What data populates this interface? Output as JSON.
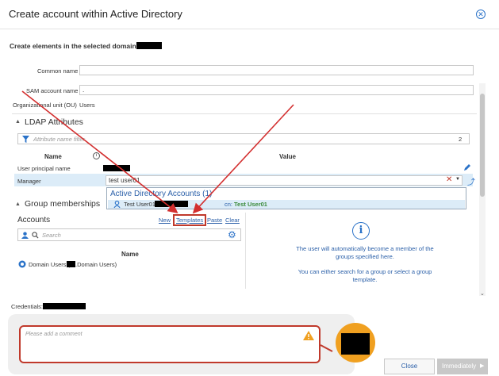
{
  "dialog": {
    "title": "Create account within Active Directory",
    "subtitle": "Create elements in the selected domain:"
  },
  "form": {
    "common_name_label": "Common name",
    "common_name_value": "",
    "sam_label": "SAM account name",
    "sam_value": ".",
    "ou_label": "Organizational unit (OU)",
    "ou_value": "Users"
  },
  "ldap": {
    "header": "LDAP Attributes",
    "filter_placeholder": "Attribute name filter",
    "filter_count": "2",
    "col_name": "Name",
    "col_value": "Value",
    "rows": [
      {
        "name": "User principal name"
      },
      {
        "name": "Manager",
        "value": "test user01"
      }
    ]
  },
  "dropdown": {
    "group_label": "Active Directory Accounts (1)",
    "item_name": "Test User01",
    "item_cn_prefix": "cn:",
    "item_cn": "Test User01"
  },
  "groups": {
    "header": "Group memberships",
    "accounts_label": "Accounts",
    "links": {
      "new": "New",
      "templates": "Templates",
      "paste": "Paste",
      "clear": "Clear"
    },
    "search_placeholder": "Search",
    "col_name": "Name",
    "items": [
      {
        "prefix": "Domain Users (",
        "suffix": ".Domain Users)"
      }
    ],
    "info_line1": "The user will automatically become a member of the",
    "info_line2": "groups specified here.",
    "info_line3": "You can either search for a group or select a group",
    "info_line4": "template."
  },
  "credentials_label": "Credentials:",
  "comment_placeholder": "Please add a comment",
  "buttons": {
    "close": "Close",
    "immediately": "Immediately"
  },
  "colors": {
    "accent": "#2a72c8",
    "annotation": "#c0392b",
    "avatar": "#f0a020",
    "highlight_row": "#dcecf8"
  },
  "icons": [
    "close-circle-icon",
    "chevron-up-icon",
    "filter-icon",
    "info-icon",
    "edit-icon",
    "upload-icon",
    "clear-x-icon",
    "dropdown-caret-icon",
    "user-icon",
    "search-icon",
    "gear-icon",
    "group-icon",
    "warning-icon",
    "play-icon"
  ]
}
